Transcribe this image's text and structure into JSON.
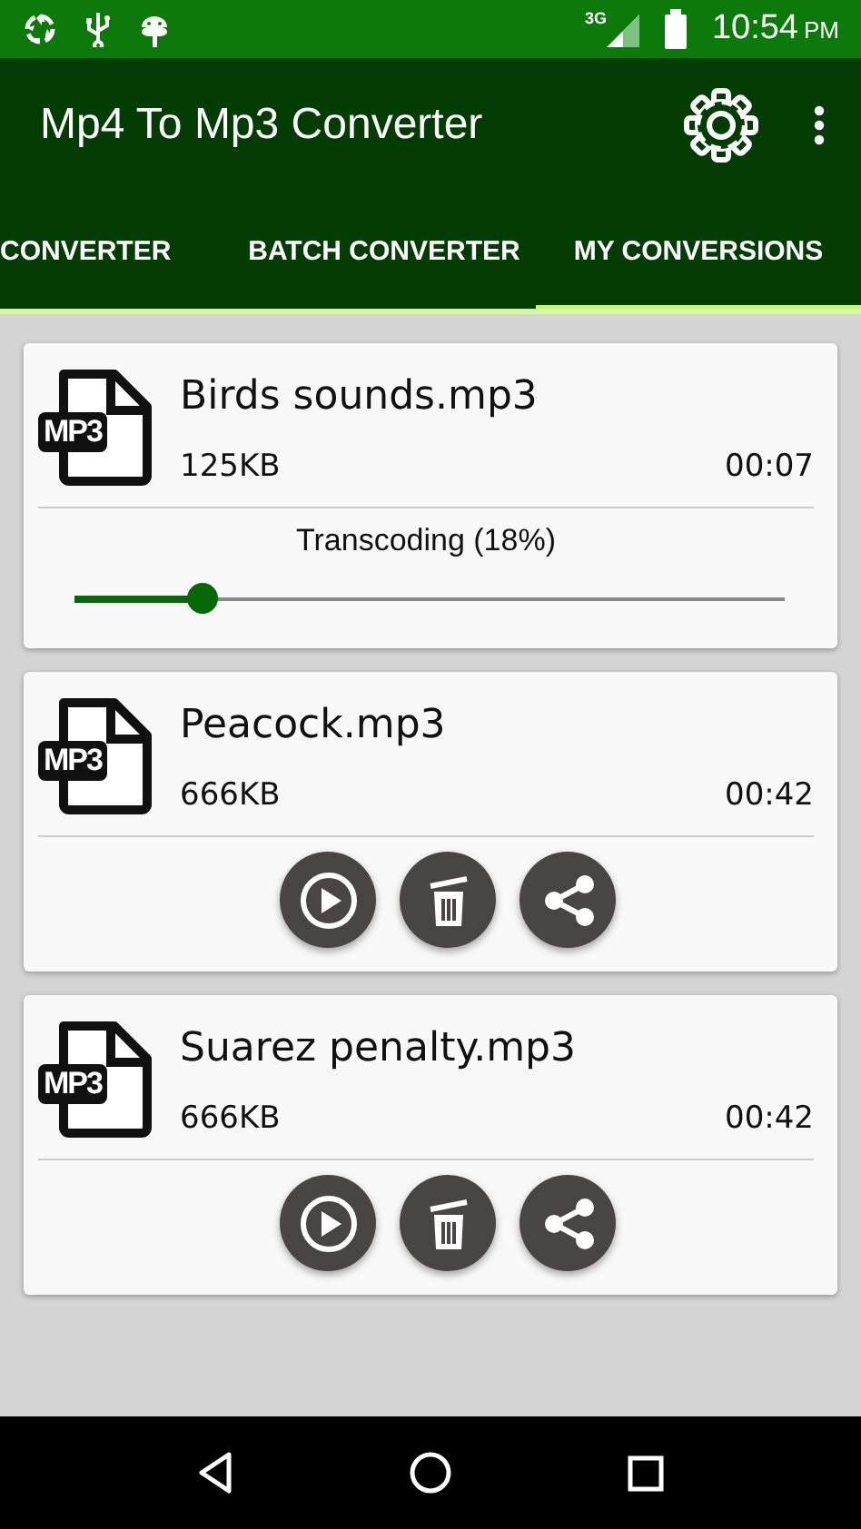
{
  "status_bar": {
    "network": "3G",
    "time": "10:54",
    "period": "PM"
  },
  "app_bar": {
    "title": "Mp4 To Mp3 Converter"
  },
  "tabs": [
    {
      "label": "CONVERTER",
      "selected": false
    },
    {
      "label": "BATCH CONVERTER",
      "selected": false
    },
    {
      "label": "MY CONVERSIONS",
      "selected": true
    }
  ],
  "conversions": [
    {
      "kind": "progress",
      "badge": "MP3",
      "name": "Birds sounds.mp3",
      "size": "125KB",
      "duration": "00:07",
      "status": "Transcoding (18%)",
      "level": 0.18
    },
    {
      "kind": "done",
      "badge": "MP3",
      "name": "Peacock.mp3",
      "size": "666KB",
      "duration": "00:42"
    },
    {
      "kind": "done",
      "badge": "MP3",
      "name": "Suarez penalty.mp3",
      "size": "666KB",
      "duration": "00:42"
    }
  ]
}
